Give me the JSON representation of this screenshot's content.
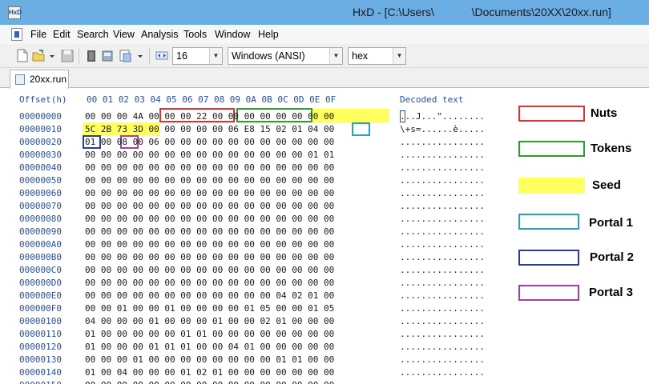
{
  "window": {
    "title": "HxD - [C:\\Users\\            \\Documents\\20XX\\20xx.run]"
  },
  "menu": [
    "File",
    "Edit",
    "Search",
    "View",
    "Analysis",
    "Tools",
    "Window",
    "Help"
  ],
  "toolbar": {
    "bytes_per_row": "16",
    "charset": "Windows (ANSI)",
    "offset_base": "hex"
  },
  "tab": {
    "label": "20xx.run"
  },
  "editor": {
    "offset_header": "Offset(h)",
    "hex_header": "00 01 02 03 04 05 06 07 08 09 0A 0B 0C 0D 0E 0F",
    "decoded_header": "Decoded text",
    "offsets": "00000000\n00000010\n00000020\n00000030\n00000040\n00000050\n00000060\n00000070\n00000080\n00000090\n000000A0\n000000B0\n000000C0\n000000D0\n000000E0\n000000F0\n00000100\n00000110\n00000120\n00000130\n00000140\n00000150",
    "hex_rows": "00 00 00 4A 00 00 00 22 00 00 00 00 00 00 00 00\n5C 2B 73 3D 00 00 00 00 00 06 E8 15 02 01 04 00\n01 00 08 00 06 00 00 00 00 00 00 00 00 00 00 00\n00 00 00 00 00 00 00 00 00 00 00 00 00 00 01 01\n00 00 00 00 00 00 00 00 00 00 00 00 00 00 00 00\n00 00 00 00 00 00 00 00 00 00 00 00 00 00 00 00\n00 00 00 00 00 00 00 00 00 00 00 00 00 00 00 00\n00 00 00 00 00 00 00 00 00 00 00 00 00 00 00 00\n00 00 00 00 00 00 00 00 00 00 00 00 00 00 00 00\n00 00 00 00 00 00 00 00 00 00 00 00 00 00 00 00\n00 00 00 00 00 00 00 00 00 00 00 00 00 00 00 00\n00 00 00 00 00 00 00 00 00 00 00 00 00 00 00 00\n00 00 00 00 00 00 00 00 00 00 00 00 00 00 00 00\n00 00 00 00 00 00 00 00 00 00 00 00 00 00 00 00\n00 00 00 00 00 00 00 00 00 00 00 00 04 02 01 00\n00 00 01 00 00 01 00 00 00 00 01 05 00 00 01 05\n04 00 00 00 01 00 00 00 01 00 00 02 01 00 00 00\n01 00 00 00 00 00 01 01 00 00 00 00 00 00 00 00\n01 00 00 00 01 01 01 00 00 04 01 00 00 00 00 00\n00 00 00 01 00 00 00 00 00 00 00 00 01 01 00 00\n01 00 04 00 00 00 01 02 01 00 00 00 00 00 00 00\n00 00 00 00 00 00 00 00 00 00 00 00 00 00 00 00",
    "decoded_rows": "...J...\"........\n\\+s=......è.....\n................\n................\n................\n................\n................\n................\n................\n................\n................\n................\n................\n................\n................\n................\n................\n................\n................\n................\n................\n................"
  },
  "legend": [
    {
      "label": "Nuts",
      "color": "#e03030"
    },
    {
      "label": "Tokens",
      "color": "#2aa02a"
    },
    {
      "label": "Seed",
      "color": "#ffff60"
    },
    {
      "label": "Portal 1",
      "color": "#2aa0c0"
    },
    {
      "label": "Portal 2",
      "color": "#2a3aa0"
    },
    {
      "label": "Portal 3",
      "color": "#a040a8"
    }
  ]
}
